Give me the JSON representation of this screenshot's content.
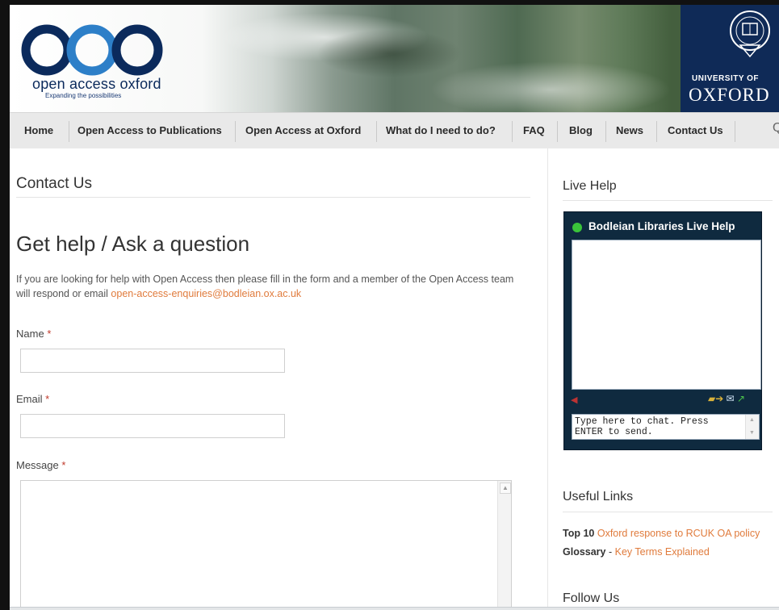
{
  "header": {
    "logo_text": "open access oxford",
    "logo_tagline": "Expanding the possibilities",
    "university_of": "UNIVERSITY OF",
    "oxford": "OXFORD"
  },
  "nav": {
    "items": [
      "Home",
      "Open Access to Publications",
      "Open Access at Oxford",
      "What do I need to do?",
      "FAQ",
      "Blog",
      "News",
      "Contact Us"
    ],
    "search_glyph": "Q"
  },
  "main": {
    "page_title": "Contact Us",
    "heading": "Get help / Ask a question",
    "intro": "If you are looking for help with Open Access then please fill in the form and a member of the Open Access team will respond or email ",
    "email_link": "open-access-enquiries@bodleian.ox.ac.uk",
    "form": {
      "name_label": "Name",
      "email_label": "Email",
      "message_label": "Message",
      "required_mark": "*"
    }
  },
  "sidebar": {
    "live_help_heading": "Live Help",
    "widget_title": "Bodleian Libraries Live Help",
    "chat_placeholder": "Type here to chat. Press ENTER to send.",
    "useful_links_heading": "Useful Links",
    "links": [
      {
        "prefix": "Top 10",
        "text": "Oxford response to RCUK OA policy"
      },
      {
        "prefix": "Glossary",
        "separator": " - ",
        "text": "Key Terms Explained"
      }
    ],
    "follow_heading": "Follow Us"
  },
  "colors": {
    "link": "#e07b3c",
    "oxford_blue": "#0f2a57",
    "widget_bg": "#0f2a3f",
    "status_online": "#3ac43a"
  }
}
